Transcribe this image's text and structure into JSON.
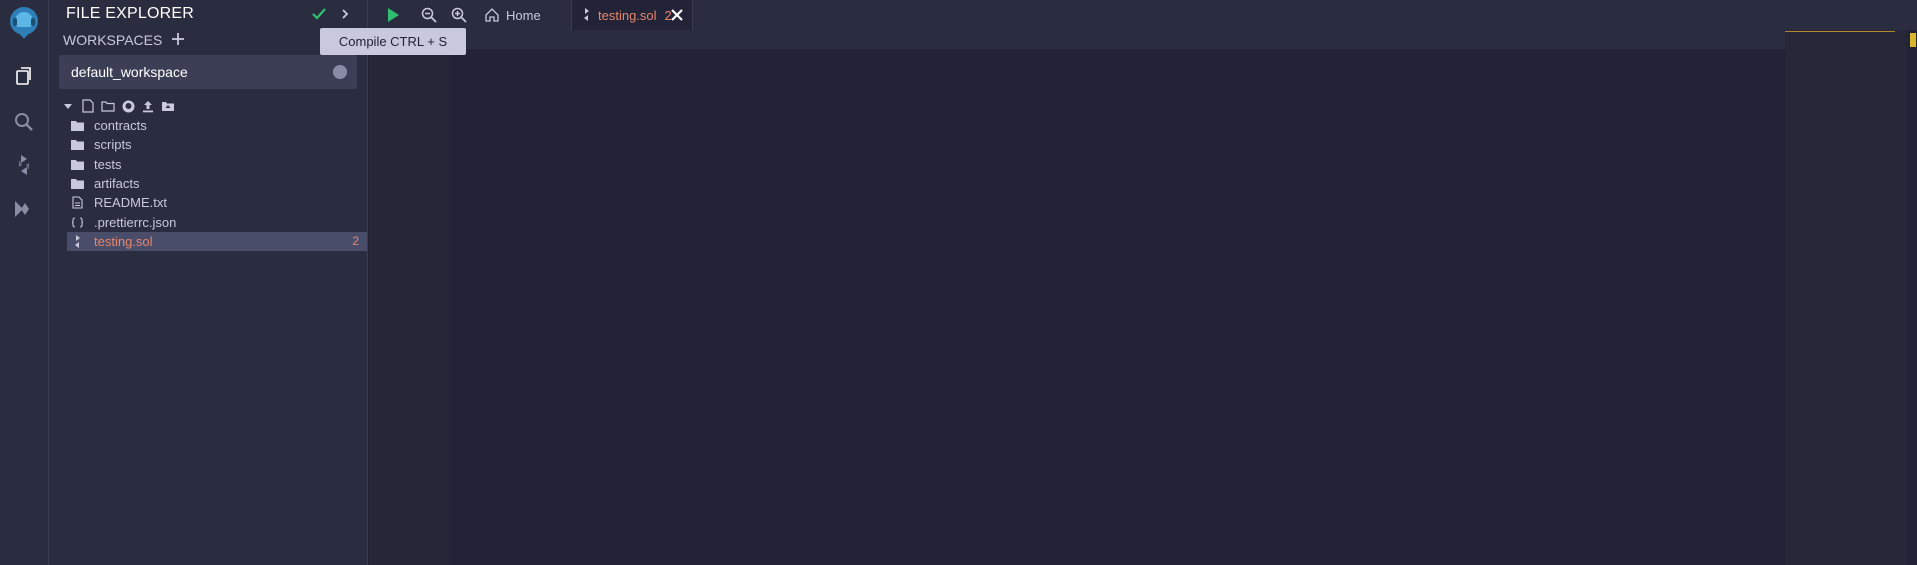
{
  "rail": {
    "icons": [
      "remix-logo-icon",
      "file-explorer-icon",
      "search-icon",
      "solidity-compiler-icon",
      "deploy-run-icon"
    ]
  },
  "panel": {
    "title": "FILE EXPLORER",
    "workspaces_label": "WORKSPACES",
    "selected_workspace": "default_workspace"
  },
  "tree": {
    "items": [
      {
        "label": "contracts",
        "icon": "folder-icon"
      },
      {
        "label": "scripts",
        "icon": "folder-icon"
      },
      {
        "label": "tests",
        "icon": "folder-icon"
      },
      {
        "label": "artifacts",
        "icon": "folder-icon"
      },
      {
        "label": "README.txt",
        "icon": "file-text-icon"
      },
      {
        "label": ".prettierrc.json",
        "icon": "json-file-icon"
      },
      {
        "label": "testing.sol",
        "icon": "solidity-file-icon",
        "badge": "2"
      }
    ]
  },
  "tabs": {
    "home": "Home",
    "active": {
      "label": "testing.sol",
      "count": "2"
    }
  },
  "tooltip": "Compile CTRL + S",
  "colors": {
    "accent": "#e4876d",
    "play": "#2fbf71",
    "bg": "#222336",
    "panel": "#2a2c3f"
  }
}
